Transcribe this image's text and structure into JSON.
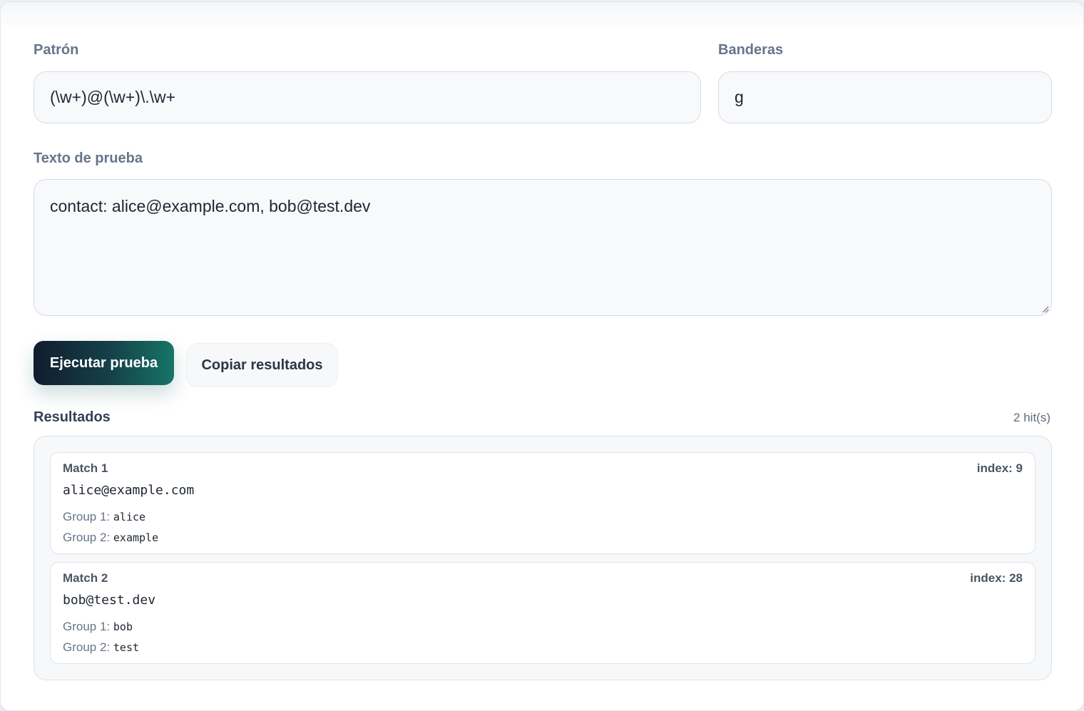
{
  "form": {
    "pattern_label": "Patrón",
    "pattern_value": "(\\w+)@(\\w+)\\.\\w+",
    "flags_label": "Banderas",
    "flags_value": "g",
    "text_label": "Texto de prueba",
    "text_value": "contact: alice@example.com, bob@test.dev"
  },
  "actions": {
    "run_label": "Ejecutar prueba",
    "copy_label": "Copiar resultados"
  },
  "results": {
    "title": "Resultados",
    "hits": "2 hit(s)",
    "matches": [
      {
        "title": "Match 1",
        "index": "index: 9",
        "value": "alice@example.com",
        "groups": [
          {
            "label": "Group 1:",
            "value": "alice"
          },
          {
            "label": "Group 2:",
            "value": "example"
          }
        ]
      },
      {
        "title": "Match 2",
        "index": "index: 28",
        "value": "bob@test.dev",
        "groups": [
          {
            "label": "Group 1:",
            "value": "bob"
          },
          {
            "label": "Group 2:",
            "value": "test"
          }
        ]
      }
    ]
  },
  "colors": {
    "primary_gradient_start": "#111c2e",
    "primary_gradient_end": "#177566",
    "label": "#66758a",
    "field_bg": "#f7f9fb",
    "field_border": "#d6dde5"
  }
}
